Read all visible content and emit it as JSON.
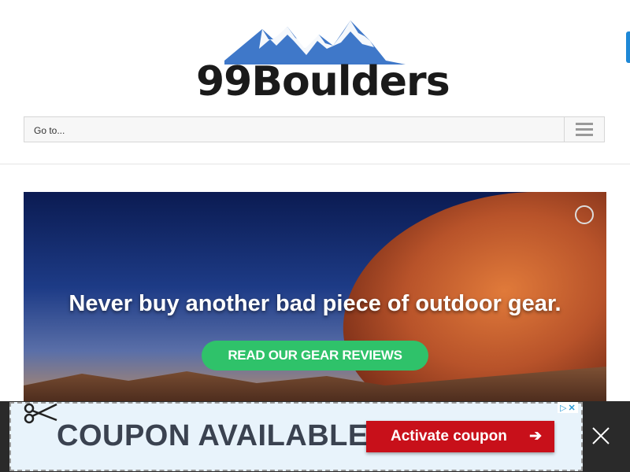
{
  "header": {
    "logo_text": "99Boulders"
  },
  "nav": {
    "select_value": "Go to...",
    "menu_icon": "hamburger-menu-icon"
  },
  "hero": {
    "headline": "Never buy another bad piece of outdoor gear.",
    "cta_label": "READ OUR GEAR REVIEWS",
    "cta_color": "#2fc26a"
  },
  "ad": {
    "title": "COUPON AVAILABLE",
    "button_label": "Activate coupon",
    "button_arrow": "➔",
    "button_color": "#c8101a",
    "adchoices_icon": "adchoices-icon",
    "close_icon": "close-icon",
    "scissors_icon": "scissors-icon"
  },
  "colors": {
    "brand_blue": "#3f78c9",
    "accent_tab": "#1e88d6"
  }
}
